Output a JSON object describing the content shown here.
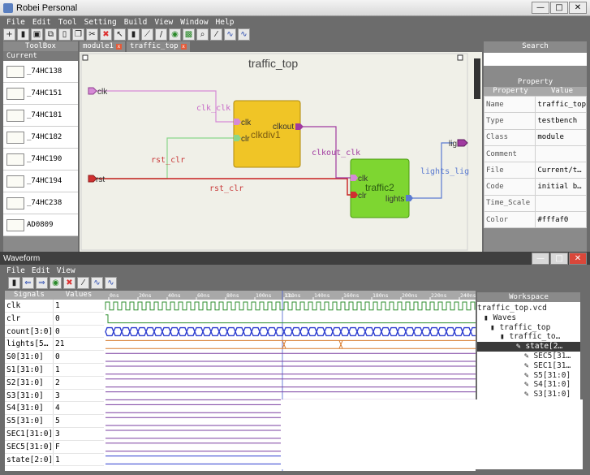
{
  "app": {
    "title": "Robei Personal",
    "controls": [
      "—",
      "□",
      "✕"
    ]
  },
  "menu": [
    "File",
    "Edit",
    "Tool",
    "Setting",
    "Build",
    "View",
    "Window",
    "Help"
  ],
  "toolbar_icons": [
    "add-icon",
    "open-icon",
    "save-icon",
    "save-all-icon",
    "new-file-icon",
    "copy-icon",
    "cut-icon",
    "delete-icon",
    "pointer-icon",
    "pin-icon",
    "connect-icon",
    "wire-icon",
    "run-icon",
    "image-icon",
    "zoom-icon",
    "probe-icon",
    "wave-icon",
    "wave-alt-icon"
  ],
  "toolbox": {
    "title": "ToolBox",
    "current": "Current",
    "items": [
      "_74HC138",
      "_74HC151",
      "_74HC181",
      "_74HC182",
      "_74HC190",
      "_74HC194",
      "_74HC238",
      "AD0809"
    ]
  },
  "tabs": [
    {
      "label": "module1"
    },
    {
      "label": "traffic_top"
    }
  ],
  "canvas": {
    "title": "traffic_top",
    "inputs": [
      "clk",
      "rst"
    ],
    "output": "lig",
    "wire_labels": {
      "clk_clk": "clk_clk",
      "rst_clr_1": "rst_clr",
      "rst_clr_2": "rst_clr",
      "clkout_clk": "clkout_clk",
      "lights_lig": "lights_lig"
    },
    "blocks": [
      {
        "name": "clkdiv1",
        "ports_in": [
          "clk",
          "clr"
        ],
        "port_out": "clkout",
        "color": "#f0c526"
      },
      {
        "name": "traffic2",
        "ports_in": [
          "clk",
          "clr"
        ],
        "port_out": "lights",
        "color": "#7ed631"
      }
    ]
  },
  "search": {
    "title": "Search"
  },
  "property": {
    "title": "Property",
    "col_property": "Property",
    "col_value": "Value",
    "rows": [
      [
        "Name",
        "traffic_top"
      ],
      [
        "Type",
        "testbench"
      ],
      [
        "Class",
        "module"
      ],
      [
        "Comment",
        ""
      ],
      [
        "File",
        "Current/t…"
      ],
      [
        "Code",
        "initial b…"
      ],
      [
        "Time_Scale",
        ""
      ],
      [
        "Color",
        "#fffaf0"
      ]
    ]
  },
  "waveform": {
    "title": "Waveform",
    "controls": [
      "—",
      "□",
      "✕"
    ],
    "menu": [
      "File",
      "Edit",
      "View"
    ],
    "toolbar_icons": [
      "cursor-icon",
      "back-icon",
      "forward-icon",
      "refresh-icon",
      "close-icon",
      "probe-icon",
      "wave-icon",
      "wave-alt-icon"
    ],
    "col_signals": "Signals",
    "col_values": "Values",
    "signals": [
      [
        "clk",
        "1"
      ],
      [
        "clr",
        "0"
      ],
      [
        "count[3:0]",
        "0"
      ],
      [
        "lights[5…",
        "21"
      ],
      [
        "S0[31:0]",
        "0"
      ],
      [
        "S1[31:0]",
        "1"
      ],
      [
        "S2[31:0]",
        "2"
      ],
      [
        "S3[31:0]",
        "3"
      ],
      [
        "S4[31:0]",
        "4"
      ],
      [
        "S5[31:0]",
        "5"
      ],
      [
        "SEC1[31:0]",
        "3"
      ],
      [
        "SEC5[31:0]",
        "F"
      ],
      [
        "state[2:0]",
        "1"
      ]
    ],
    "time_labels": [
      "0ns",
      "20ns",
      "40ns",
      "60ns",
      "80ns",
      "100ns",
      "120ns",
      "140ns",
      "160ns",
      "180ns",
      "200ns",
      "220ns",
      "240ns"
    ],
    "cursor_label": "13…",
    "colors": {
      "clk": "#2f8f2f",
      "count": "#2f3fd0",
      "lights": "#d87a2c",
      "bus": "#7a3fa0",
      "cursor": "#4a5fd0"
    }
  },
  "workspace": {
    "title": "Workspace",
    "items": [
      "traffic_top.vcd",
      "Waves",
      "traffic_top",
      "traffic_to…",
      "state[2…",
      "SEC5[31…",
      "SEC1[31…",
      "S5[31:0]",
      "S4[31:0]",
      "S3[31:0]"
    ]
  }
}
